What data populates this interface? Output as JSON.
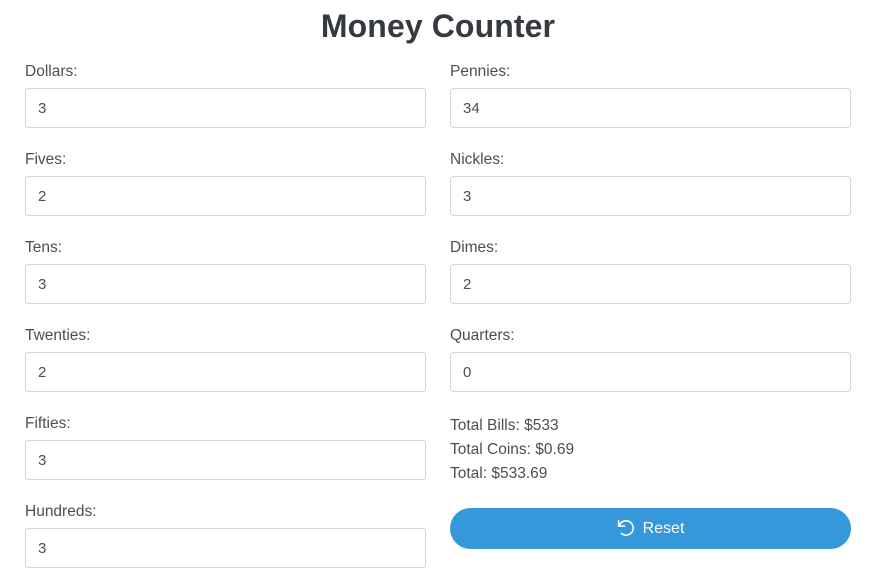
{
  "header": {
    "title": "Money Counter"
  },
  "bills": [
    {
      "label": "Dollars:",
      "value": "3",
      "name": "dollars"
    },
    {
      "label": "Fives:",
      "value": "2",
      "name": "fives"
    },
    {
      "label": "Tens:",
      "value": "3",
      "name": "tens"
    },
    {
      "label": "Twenties:",
      "value": "2",
      "name": "twenties"
    },
    {
      "label": "Fifties:",
      "value": "3",
      "name": "fifties"
    },
    {
      "label": "Hundreds:",
      "value": "3",
      "name": "hundreds"
    }
  ],
  "coins": [
    {
      "label": "Pennies:",
      "value": "34",
      "name": "pennies"
    },
    {
      "label": "Nickles:",
      "value": "3",
      "name": "nickles"
    },
    {
      "label": "Dimes:",
      "value": "2",
      "name": "dimes"
    },
    {
      "label": "Quarters:",
      "value": "0",
      "name": "quarters"
    }
  ],
  "totals": {
    "bills_line": "Total Bills: $533",
    "coins_line": "Total Coins: $0.69",
    "total_line": "Total: $533.69",
    "bills_amount": "$533",
    "coins_amount": "$0.69",
    "total_amount": "$533.69"
  },
  "reset": {
    "label": "Reset",
    "icon": "rotate-left-icon"
  },
  "colors": {
    "accent": "#3498db",
    "title": "#343a40",
    "text": "#495057",
    "input_border": "#ced4da",
    "background": "#ffffff"
  }
}
